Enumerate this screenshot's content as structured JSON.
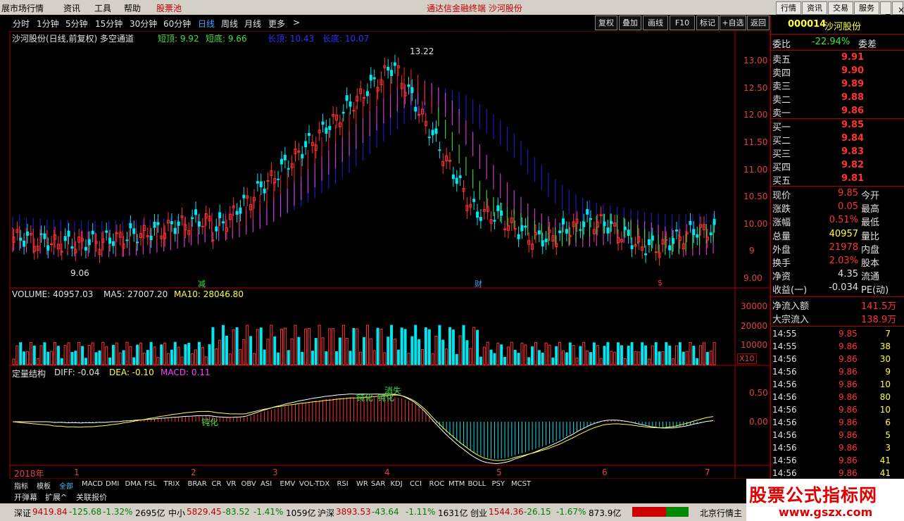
{
  "menubar": {
    "items": [
      "展市场行情",
      "资讯",
      "工具",
      "帮助",
      "股票池"
    ],
    "center": "通达信金融终端  沙河股份",
    "buttons": [
      "行情",
      "资讯",
      "交易",
      "服务"
    ]
  },
  "toolbar": {
    "periods": [
      "分时",
      "1分钟",
      "5分钟",
      "15分钟",
      "30分钟",
      "60分钟",
      "日线",
      "周线",
      "月线",
      "更多"
    ],
    "more_arrow": ">",
    "right_buttons": [
      "复权",
      "叠加",
      "画线",
      "F10",
      "标记",
      "+自选",
      "返回"
    ]
  },
  "chart": {
    "title": "沙河股份(日线,前复权) 多空通道",
    "short_top": "短顶: 9.92",
    "short_bottom": "短底: 9.66",
    "long_top": "长顶: 10.43",
    "long_bottom": "长底: 10.07",
    "high_mark": "13.22",
    "low_mark": "9.06",
    "price_ticks": [
      "13.00",
      "12.50",
      "12.00",
      "11.50",
      "11.00",
      "10.50",
      "10.00",
      "9",
      "9.00"
    ],
    "flag_jian": "减",
    "flag_cai": "财",
    "flag_s": "$",
    "volume_info_prefix": "VOLUME: 40957.03",
    "volume_ma5": "MA5: 27007.20",
    "volume_ma10": "MA10: 28046.80",
    "volume_ticks": [
      "30000",
      "20000",
      "10000"
    ],
    "volume_unit": "X10",
    "macd_title": "定量结构",
    "macd_diff": "DIFF: -0.04",
    "macd_dea": "DEA: -0.10",
    "macd_val": "MACD: 0.11",
    "macd_ticks": [
      "0.50",
      "0.00"
    ],
    "macd_labels": [
      "钝化",
      "钝化",
      "钝化",
      "消失"
    ],
    "x_labels": [
      "2018年",
      "1",
      "2",
      "3",
      "4",
      "5",
      "6",
      "7"
    ]
  },
  "right_panel": {
    "code": "000014",
    "name": "沙河股份",
    "weibi_label": "委比",
    "weibi_value": "-22.94%",
    "weicha_label": "委差",
    "asks": [
      {
        "label": "卖五",
        "price": "9.91"
      },
      {
        "label": "卖四",
        "price": "9.90"
      },
      {
        "label": "卖三",
        "price": "9.89"
      },
      {
        "label": "卖二",
        "price": "9.88"
      },
      {
        "label": "卖一",
        "price": "9.86"
      }
    ],
    "bids": [
      {
        "label": "买一",
        "price": "9.85"
      },
      {
        "label": "买二",
        "price": "9.84"
      },
      {
        "label": "买三",
        "price": "9.83"
      },
      {
        "label": "买四",
        "price": "9.82"
      },
      {
        "label": "买五",
        "price": "9.81"
      }
    ],
    "stats": [
      {
        "label": "现价",
        "value": "9.85",
        "label2": "今开"
      },
      {
        "label": "涨跌",
        "value": "0.05",
        "label2": "最高"
      },
      {
        "label": "涨幅",
        "value": "0.51%",
        "label2": "最低"
      },
      {
        "label": "总量",
        "value": "40957",
        "label2": "量比"
      },
      {
        "label": "外盘",
        "value": "21978",
        "label2": "内盘"
      },
      {
        "label": "换手",
        "value": "2.03%",
        "label2": "股本"
      },
      {
        "label": "净资",
        "value": "4.35",
        "label2": "流通"
      },
      {
        "label": "收益(一)",
        "value": "-0.034",
        "label2": "PE(动)"
      }
    ],
    "flow": [
      {
        "label": "净流入额",
        "value": "141.5万"
      },
      {
        "label": "大宗流入",
        "value": "138.9万"
      }
    ],
    "ticks": [
      {
        "time": "14:55",
        "price": "9.85",
        "vol": "7"
      },
      {
        "time": "14:55",
        "price": "9.86",
        "vol": "38"
      },
      {
        "time": "14:56",
        "price": "9.86",
        "vol": "30"
      },
      {
        "time": "14:56",
        "price": "9.86",
        "vol": "9"
      },
      {
        "time": "14:56",
        "price": "9.86",
        "vol": "10"
      },
      {
        "time": "14:56",
        "price": "9.86",
        "vol": "80"
      },
      {
        "time": "14:56",
        "price": "9.86",
        "vol": "10"
      },
      {
        "time": "14:56",
        "price": "9.86",
        "vol": "6"
      },
      {
        "time": "14:56",
        "price": "9.86",
        "vol": "5"
      },
      {
        "time": "14:56",
        "price": "9.86",
        "vol": "3"
      },
      {
        "time": "14:56",
        "price": "9.86",
        "vol": "41"
      },
      {
        "time": "14:56",
        "price": "9.86",
        "vol": "41"
      }
    ]
  },
  "bottom_tabs": [
    "指标",
    "模板",
    "全部",
    "MACD",
    "DMI",
    "DMA",
    "FSL",
    "TRIX",
    "BRAR",
    "CR",
    "VR",
    "OBV",
    "ASI",
    "EMV",
    "VOL-TDX",
    "RSI",
    "WR",
    "SAR",
    "KDJ",
    "CCI",
    "ROC",
    "MTM",
    "BOLL",
    "PSY",
    "MCST"
  ],
  "sub_tabs": [
    "开弹幕",
    "扩展^",
    "关联报价"
  ],
  "status": {
    "sz_label": "深证",
    "sz_value": "9419.84",
    "sz_chg": "-125.68",
    "sz_pct": "-1.32%",
    "sz_amt": "2695亿",
    "zx_label": "中小",
    "zx_value": "5829.45",
    "zx_chg": "-83.52",
    "zx_pct": "-1.41%",
    "zx_amt": "1059亿",
    "hs_label": "沪深",
    "hs_value": "3893.53",
    "hs_chg": "-43.64",
    "hs_pct": "-1.11%",
    "hs_amt": "1631亿",
    "cy_label": "创业",
    "cy_value": "1544.36",
    "cy_chg": "-26.15",
    "cy_pct": "-1.67%",
    "cy_amt": "873.9亿",
    "right_text": "北京行情主"
  },
  "brand": {
    "title": "股票公式指标网",
    "url": "www.gszx.com"
  },
  "colors": {
    "up": "#ff3333",
    "down": "#00e5ee",
    "channel_long": "#2020d0",
    "channel_mid": "#e040e0",
    "channel_short_up": "#e02020",
    "channel_short_dn": "#40e040"
  }
}
